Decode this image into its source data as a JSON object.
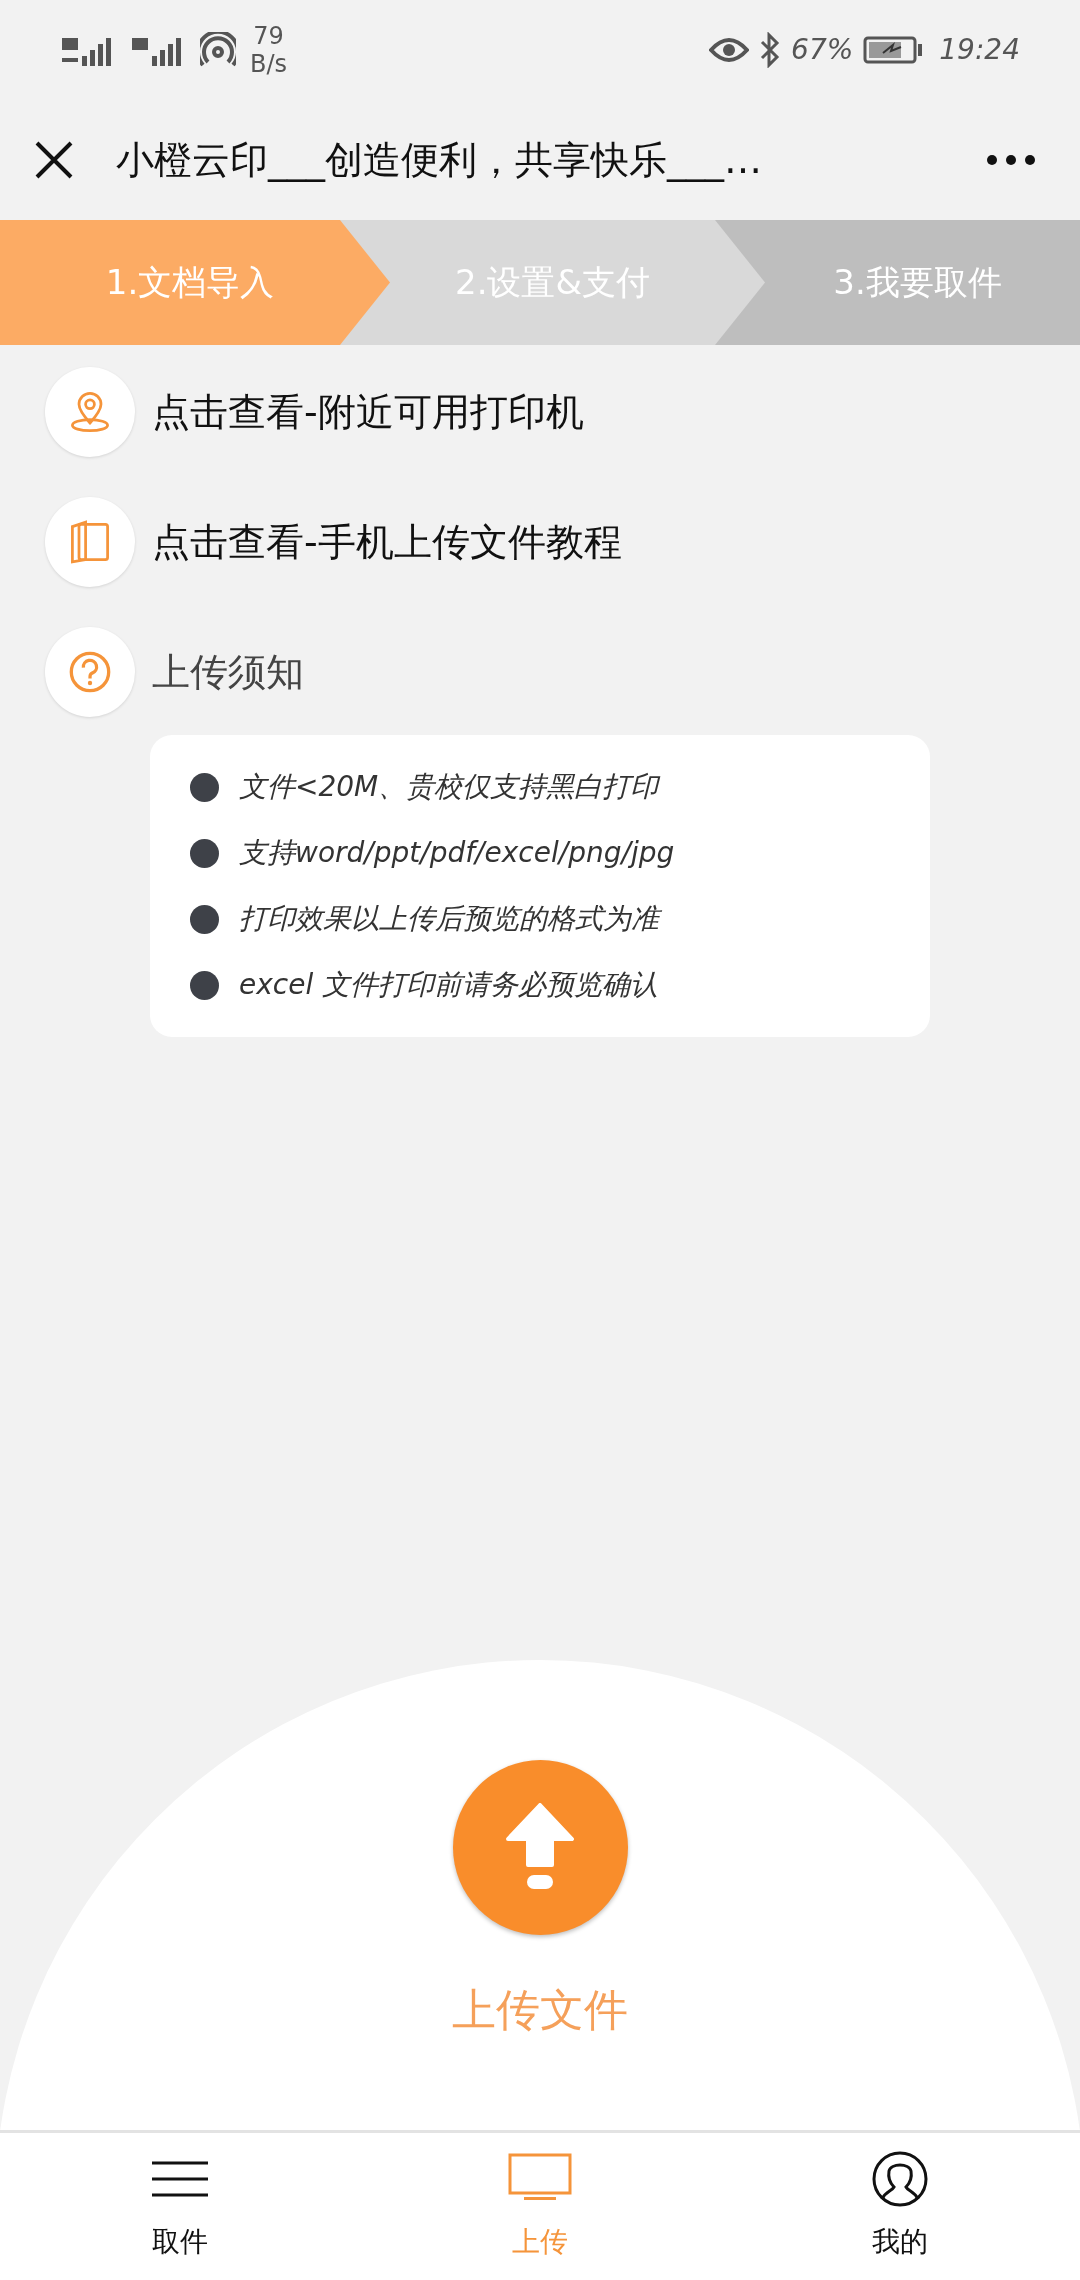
{
  "status_bar": {
    "net_speed_value": "79",
    "net_speed_unit": "B/s",
    "battery": "67%",
    "time": "19:24"
  },
  "title_bar": {
    "title": "小橙云印___创造便利，共享快乐___…"
  },
  "steps": [
    {
      "label": "1.文档导入",
      "selected": true
    },
    {
      "label": "2.设置&支付",
      "selected": false
    },
    {
      "label": "3.我要取件",
      "selected": false
    }
  ],
  "links": [
    {
      "label": "点击查看-附近可用打印机"
    },
    {
      "label": "点击查看-手机上传文件教程"
    },
    {
      "label": "上传须知"
    }
  ],
  "notice": [
    "文件<20M、贵校仅支持黑白打印",
    "支持word/ppt/pdf/excel/png/jpg",
    "打印效果以上传后预览的格式为准",
    "excel 文件打印前请务必预览确认"
  ],
  "upload": {
    "label": "上传文件"
  },
  "nav": [
    {
      "label": "取件",
      "selected": false
    },
    {
      "label": "上传",
      "selected": true
    },
    {
      "label": "我的",
      "selected": false
    }
  ]
}
